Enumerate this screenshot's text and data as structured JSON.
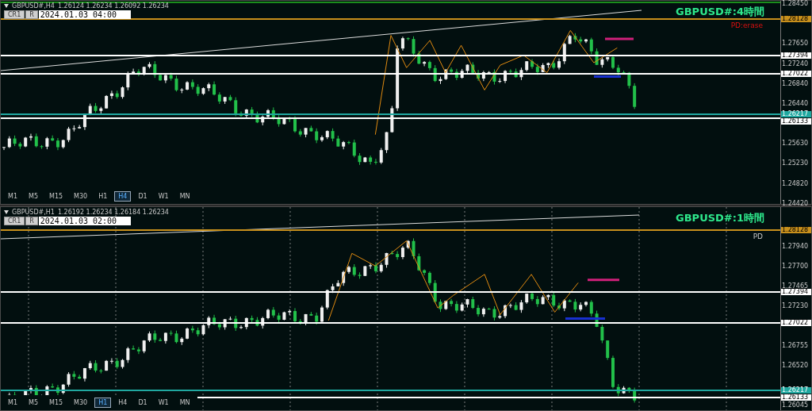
{
  "panes": [
    {
      "symbol": "GBPUSD#,H4",
      "ohlc": "1.26124 1.26234 1.26092 1.26234",
      "buttons": [
        "CR1",
        "R"
      ],
      "date": "2024.01.03 04:00",
      "title": "GBPUSD#:4時間",
      "note": {
        "text": "PD:erase",
        "kind": "alert"
      },
      "ticks": [
        "1.28450",
        "1.27650",
        "1.27240",
        "1.26840",
        "1.26440",
        "1.25630",
        "1.25230",
        "1.24820",
        "1.24420"
      ],
      "levels": [
        {
          "price": "1.28128",
          "color": "#c8901c"
        },
        {
          "price": "1.27394",
          "color": "#ffffff"
        },
        {
          "price": "1.27022",
          "color": "#ffffff"
        },
        {
          "price": "1.26217",
          "color": "#20a8a0"
        },
        {
          "price": "1.26133",
          "color": "#ffffff"
        }
      ],
      "timeframes": [
        {
          "label": "M1",
          "selected": false
        },
        {
          "label": "M5",
          "selected": false
        },
        {
          "label": "M15",
          "selected": false
        },
        {
          "label": "M30",
          "selected": false
        },
        {
          "label": "H1",
          "selected": false
        },
        {
          "label": "H4",
          "selected": true
        },
        {
          "label": "D1",
          "selected": false
        },
        {
          "label": "W1",
          "selected": false
        },
        {
          "label": "MN",
          "selected": false
        }
      ]
    },
    {
      "symbol": "GBPUSD#,H1",
      "ohlc": "1.26192 1.26234 1.26184 1.26234",
      "buttons": [
        "CR1",
        "R"
      ],
      "date": "2024.01.03 02:00",
      "title": "GBPUSD#:1時間",
      "note": {
        "text": "PD",
        "kind": "info"
      },
      "ticks": [
        "1.27940",
        "1.27700",
        "1.27465",
        "1.27230",
        "1.26755",
        "1.26520",
        "1.26045"
      ],
      "levels": [
        {
          "price": "1.28128",
          "color": "#c8901c"
        },
        {
          "price": "1.27394",
          "color": "#ffffff"
        },
        {
          "price": "1.27022",
          "color": "#ffffff"
        },
        {
          "price": "1.26217",
          "color": "#20a8a0"
        },
        {
          "price": "1.26133",
          "color": "#ffffff"
        }
      ],
      "timeframes": [
        {
          "label": "M1",
          "selected": false
        },
        {
          "label": "M5",
          "selected": false
        },
        {
          "label": "M15",
          "selected": false
        },
        {
          "label": "M30",
          "selected": false
        },
        {
          "label": "H1",
          "selected": true
        },
        {
          "label": "H4",
          "selected": false
        },
        {
          "label": "D1",
          "selected": false
        },
        {
          "label": "W1",
          "selected": false
        },
        {
          "label": "MN",
          "selected": false
        }
      ]
    }
  ]
}
